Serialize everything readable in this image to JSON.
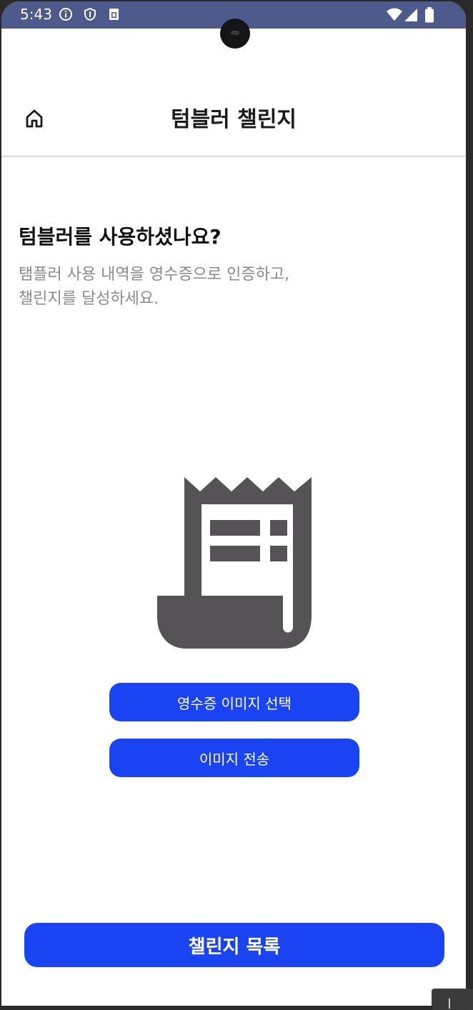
{
  "status_bar": {
    "time": "5:43",
    "icons": [
      "info-icon",
      "shield-icon",
      "sim-card-icon"
    ],
    "right_icons": [
      "wifi-icon",
      "signal-icon",
      "battery-icon"
    ]
  },
  "app_bar": {
    "title": "텀블러 챌린지",
    "home_icon": "home-icon"
  },
  "content": {
    "heading": "텀블러를 사용하셨나요?",
    "subtext_line1": "탬플러 사용 내역을 영수증으로 인증하고,",
    "subtext_line2": "챌린지를 달성하세요.",
    "illustration": "receipt-icon"
  },
  "buttons": {
    "select_image": "영수증 이미지 선택",
    "send_image": "이미지 전송",
    "challenge_list": "챌린지 목록"
  },
  "colors": {
    "status_bar": "#4f5a8c",
    "primary": "#1a44f2",
    "icon_gray": "#555355"
  }
}
